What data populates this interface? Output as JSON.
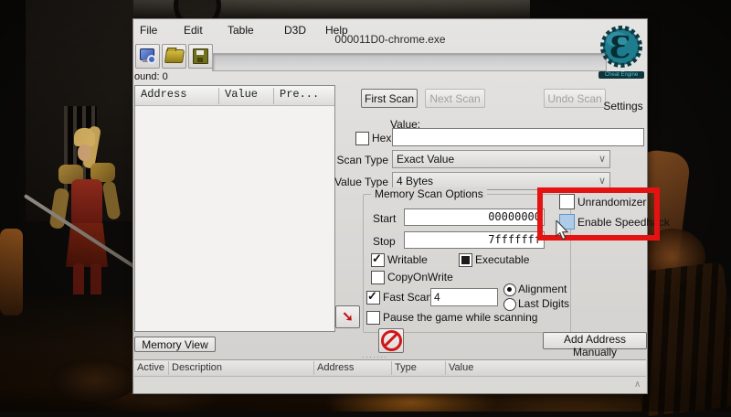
{
  "icons": {
    "chevron_down": "∨",
    "check": "✓",
    "resize_grip": "∧",
    "copy_to_list_arrow": "➘",
    "splitter_dots": "·······"
  },
  "menu": {
    "items": [
      "File",
      "Edit",
      "Table",
      "D3D",
      "Help"
    ]
  },
  "header": {
    "title": "000011D0-chrome.exe",
    "found_label": "ound: 0"
  },
  "results_list": {
    "columns": [
      "Address",
      "Value",
      "Pre..."
    ]
  },
  "scan_controls": {
    "first_scan": "First Scan",
    "next_scan": "Next Scan",
    "undo_scan": "Undo Scan",
    "value_label": "Value:",
    "hex_label": "Hex",
    "value_text": "",
    "scan_type_label": "Scan Type",
    "scan_type_value": "Exact Value",
    "value_type_label": "Value Type",
    "value_type_value": "4 Bytes"
  },
  "logo": {
    "caption": "Cheat Engine",
    "settings_label": "Settings"
  },
  "memory_scan_options": {
    "legend": "Memory Scan Options",
    "start_label": "Start",
    "start_value": "00000000",
    "stop_label": "Stop",
    "stop_value": "7fffffff",
    "writable_label": "Writable",
    "executable_label": "Executable",
    "copy_on_write_label": "CopyOnWrite",
    "fast_scan_label": "Fast Scan",
    "fast_scan_value": "4",
    "alignment_label": "Alignment",
    "last_digits_label": "Last Digits",
    "pause_label": "Pause the game while scanning"
  },
  "hack_options": {
    "unrandomizer_label": "Unrandomizer",
    "speedhack_label": "Enable Speedhack"
  },
  "footer": {
    "memory_view": "Memory View",
    "add_address_manually": "Add Address Manually"
  },
  "address_list": {
    "columns": [
      "Active",
      "Description",
      "Address",
      "Type",
      "Value"
    ]
  },
  "annotation": {
    "highlight_color": "#e51212"
  }
}
